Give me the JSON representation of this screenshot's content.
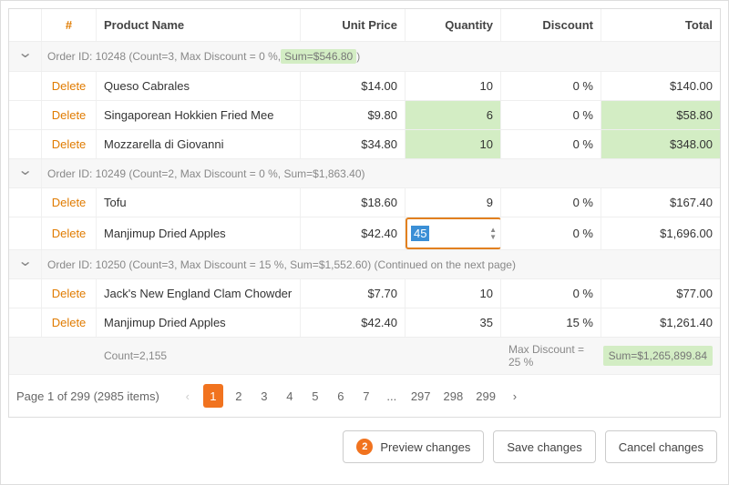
{
  "columns": {
    "expand": "#",
    "product": "Product Name",
    "unit": "Unit Price",
    "qty": "Quantity",
    "disc": "Discount",
    "total": "Total"
  },
  "delete_label": "Delete",
  "groups": [
    {
      "header_prefix": "Order ID: 10248 (Count=3, Max Discount = 0 %, ",
      "header_sum": "Sum=$546.80",
      "header_suffix": ")",
      "highlight_sum": true,
      "rows": [
        {
          "product": "Queso Cabrales",
          "unit": "$14.00",
          "qty": "10",
          "disc": "0 %",
          "total": "$140.00",
          "hl_qty": false,
          "hl_total": false
        },
        {
          "product": "Singaporean Hokkien Fried Mee",
          "unit": "$9.80",
          "qty": "6",
          "disc": "0 %",
          "total": "$58.80",
          "hl_qty": true,
          "hl_total": true
        },
        {
          "product": "Mozzarella di Giovanni",
          "unit": "$34.80",
          "qty": "10",
          "disc": "0 %",
          "total": "$348.00",
          "hl_qty": true,
          "hl_total": true
        }
      ]
    },
    {
      "header_prefix": "Order ID: 10249 (Count=2, Max Discount = 0 %, Sum=$1,863.40)",
      "header_sum": "",
      "header_suffix": "",
      "highlight_sum": false,
      "rows": [
        {
          "product": "Tofu",
          "unit": "$18.60",
          "qty": "9",
          "disc": "0 %",
          "total": "$167.40",
          "hl_qty": false,
          "hl_total": false
        },
        {
          "product": "Manjimup Dried Apples",
          "unit": "$42.40",
          "qty": "45",
          "disc": "0 %",
          "total": "$1,696.00",
          "editing_qty": true
        }
      ]
    },
    {
      "header_prefix": "Order ID: 10250 (Count=3, Max Discount = 15 %, Sum=$1,552.60) (Continued on the next page)",
      "header_sum": "",
      "header_suffix": "",
      "highlight_sum": false,
      "rows": [
        {
          "product": "Jack's New England Clam Chowder",
          "unit": "$7.70",
          "qty": "10",
          "disc": "0 %",
          "total": "$77.00"
        },
        {
          "product": "Manjimup Dried Apples",
          "unit": "$42.40",
          "qty": "35",
          "disc": "15 %",
          "total": "$1,261.40"
        }
      ]
    }
  ],
  "footer": {
    "count": "Count=2,155",
    "maxdisc": "Max Discount = 25 %",
    "sum": "Sum=$1,265,899.84"
  },
  "pager": {
    "info": "Page 1 of 299 (2985 items)",
    "pages_left": [
      "1",
      "2",
      "3",
      "4",
      "5",
      "6",
      "7"
    ],
    "ellipsis": "...",
    "pages_right": [
      "297",
      "298",
      "299"
    ]
  },
  "toolbar": {
    "preview_badge": "2",
    "preview": "Preview changes",
    "save": "Save changes",
    "cancel": "Cancel changes"
  }
}
